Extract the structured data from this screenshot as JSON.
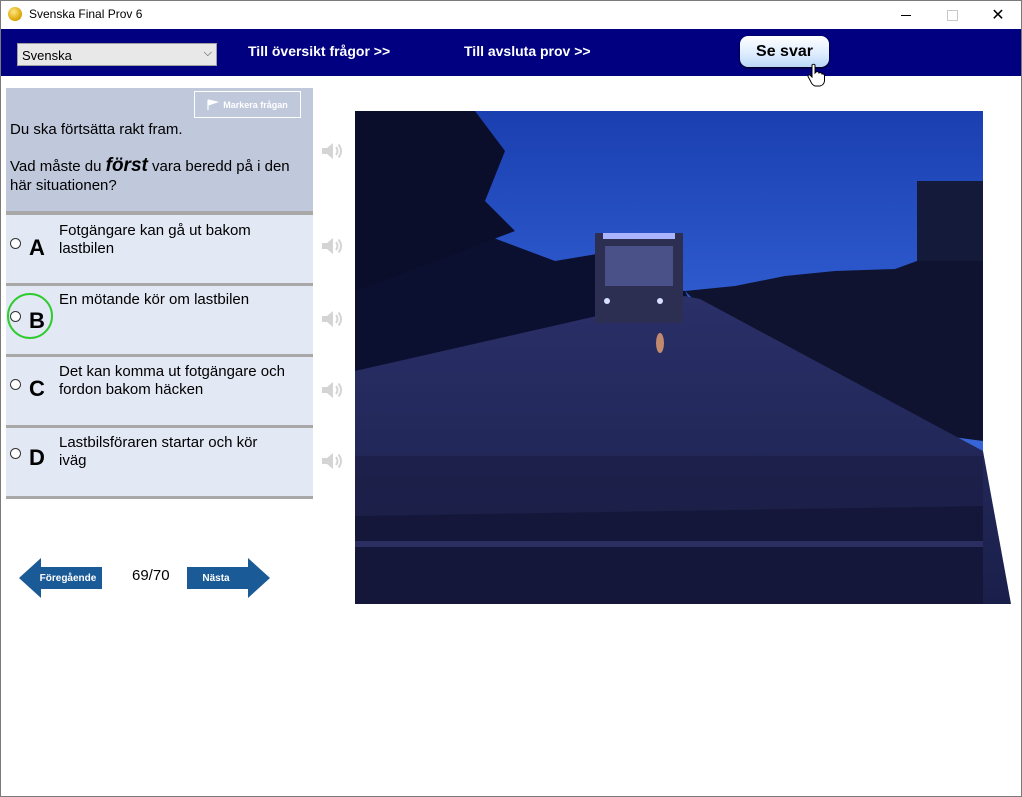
{
  "window": {
    "title": "Svenska Final Prov 6",
    "controls": {
      "minimize": "minimize-icon",
      "maximize": "maximize-icon",
      "close": "✕"
    }
  },
  "nav": {
    "language": "Svenska",
    "overview_link": "Till översikt frågor >>",
    "finish_link": "Till avsluta prov  >>",
    "show_answer": "Se svar"
  },
  "question": {
    "flag_label": "Markera frågan",
    "line1": "Du ska förtsätta rakt fram.",
    "prefix": "Vad måste du",
    "emphasis": "först",
    "suffix": "vara beredd på i den här situationen?"
  },
  "answers": [
    {
      "letter": "A",
      "text": "Fotgängare kan gå ut bakom lastbilen",
      "highlighted": false
    },
    {
      "letter": "B",
      "text": "En mötande kör om lastbilen",
      "highlighted": true
    },
    {
      "letter": "C",
      "text": "Det kan komma ut fotgängare och fordon bakom häcken",
      "highlighted": false
    },
    {
      "letter": "D",
      "text": "Lastbilsföraren startar och kör iväg",
      "highlighted": false
    }
  ],
  "footer": {
    "prev": "Föregående",
    "next": "Nästa",
    "counter": "69/70"
  },
  "colors": {
    "navbar": "#000080",
    "question_bg": "#c0c8dc",
    "answer_bg": "#e3e8f5",
    "arrow": "#1a5a96",
    "highlight_ring": "#2ecc2e"
  },
  "icons": {
    "speaker": "speaker-icon",
    "flag": "flag-icon",
    "cursor": "hand-cursor-icon"
  }
}
